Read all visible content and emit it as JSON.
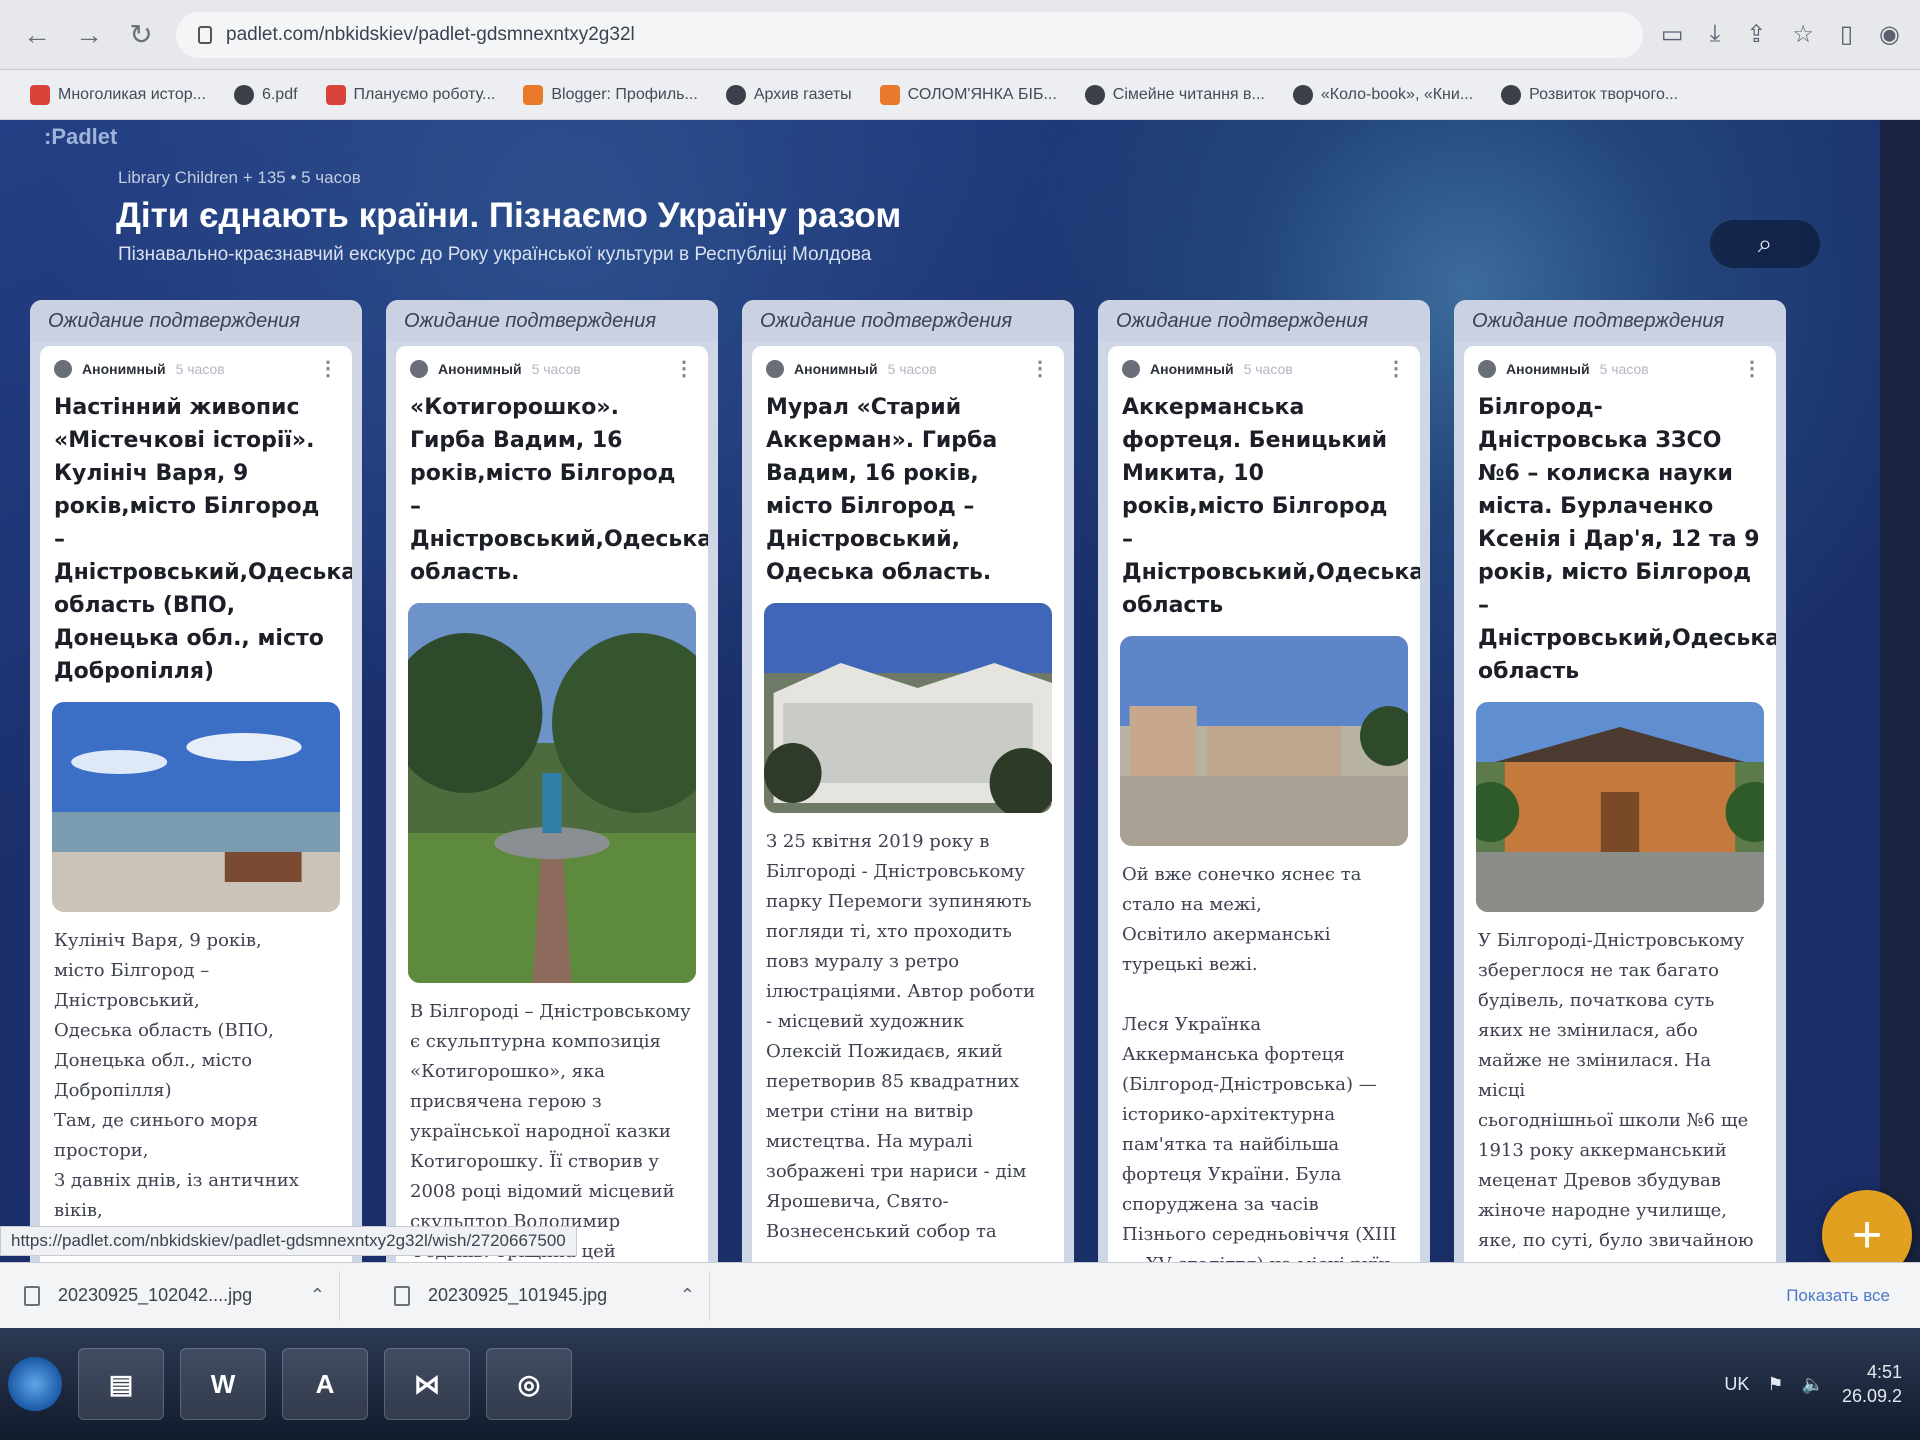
{
  "browser": {
    "url": "padlet.com/nbkidskiev/padlet-gdsmnexntxy2g32l",
    "status_url": "https://padlet.com/nbkidskiev/padlet-gdsmnexntxy2g32l/wish/2720667500",
    "bookmarks": [
      "Многоликая истор...",
      "6.pdf",
      "Плануємо роботу...",
      "Blogger: Профиль...",
      "Архив газеты",
      "СОЛОМ'ЯНКА БІБ...",
      "Сімейне читання в...",
      "«Коло-book», «Кни...",
      "Розвиток творчого..."
    ]
  },
  "padlet": {
    "brand": ":Padlet",
    "meta": "Library Children + 135 •  5 часов",
    "title": "Діти єднають країни. Пізнаємо Україну разом",
    "subtitle": "Пізнавально-краєзнавчий екскурс до Року української культури в Республіці Молдова",
    "columns": [
      {
        "header": "Ожидание подтверждения",
        "author": "Анонимный",
        "time": "5 часов",
        "title": "Настінний живопис «Містечкові історії». Кулініч Варя, 9 років,місто Білгород – Дністровський,Одеська область (ВПО, Донецька обл., місто Добропілля)",
        "body": "Кулініч Варя, 9 років,\nмісто Білгород –\nДністровський,\nОдеська область (ВПО,\nДонецька обл., місто\nДобропілля)\nТам, де синього моря\nпростори,\nЗ давніх днів, із античних\nвіків,\nБіле місто стоїть у дозорі,"
      },
      {
        "header": "Ожидание подтверждения",
        "author": "Анонимный",
        "time": "5 часов",
        "title": "«Котигорошко». Гирба Вадим, 16 років,місто Білгород – Дністровський,Одеська область.",
        "body": "В Білгороді – Дністровському\nє скульптурна композиція\n«Котигорошко», яка\nприсвячена герою з\nукраїнської народної казки\nКотигорошку. Її створив у\n2008 році відомий місцевий\nскульптор Володимир\nФедьків. Тріщина цей"
      },
      {
        "header": "Ожидание подтверждения",
        "author": "Анонимный",
        "time": "5 часов",
        "title": "Мурал «Старий Аккерман». Гирба Вадим, 16 років, місто Білгород – Дністровський, Одеська область.",
        "body": "З 25 квітня 2019 року в\nБілгороді - Дністровському\nпарку Перемоги зупиняють\nпогляди ті, хто проходить\nповз муралу з ретро\nілюстраціями. Автор роботи\n- місцевий художник\nОлексій Пожидаєв, який\nперетворив 85 квадратних\nметри стіни на витвір\nмистецтва. На муралі\nзображені три нариси - дім\nЯрошевича, Свято-\nВознесенський собор та"
      },
      {
        "header": "Ожидание подтверждения",
        "author": "Анонимный",
        "time": "5 часов",
        "title": "Аккерманська фортеця. Беницький Микита, 10 років,місто Білгород – Дністровський,Одеська область",
        "body": "Ой вже сонечко яснеє та\nстало на межі,\nОсвітило акерманські\nтурецькі вежі.\n\nЛеся Українка\n      Аккерманська фортеця\n(Білгород-Дністровська) —\nісторико-архітектурна\nпам'ятка та найбільша\nфортеця України. Була\nспоруджена за часів\nПізнього середньовіччя (XIII\n— XV століття) на місці руїн\nантичного поліса Тіра"
      },
      {
        "header": "Ожидание подтверждения",
        "author": "Анонимный",
        "time": "5 часов",
        "title": "Білгород-Дністровська ЗЗСО №6 – колиска науки міста. Бурлаченко Ксенія і Дар'я, 12 та 9 років, місто Білгород – Дністровський,Одеська область",
        "body": "У Білгороді-Дністровському\nзбереглося не так багато\nбудівель, початкова суть\nяких не змінилася, або\nмайже не змінилася. На місці\nсьогоднішньої школи №6 ще\n1913 року аккерманський\nмеценат Древов збудував\nжіноче народне училище,\nяке, по суті, було звичайною\nшколою, але для дівчаток. У\nрізні часи тут було румунське"
      }
    ]
  },
  "downloads": {
    "files": [
      "20230925_102042....jpg",
      "20230925_101945.jpg"
    ],
    "show_all": "Показать все"
  },
  "taskbar": {
    "lang": "UK",
    "time": "4:51",
    "date": "26.09.2"
  },
  "colors": {
    "accent_fab": "#e2a021",
    "board_bg": "#1f3474"
  }
}
